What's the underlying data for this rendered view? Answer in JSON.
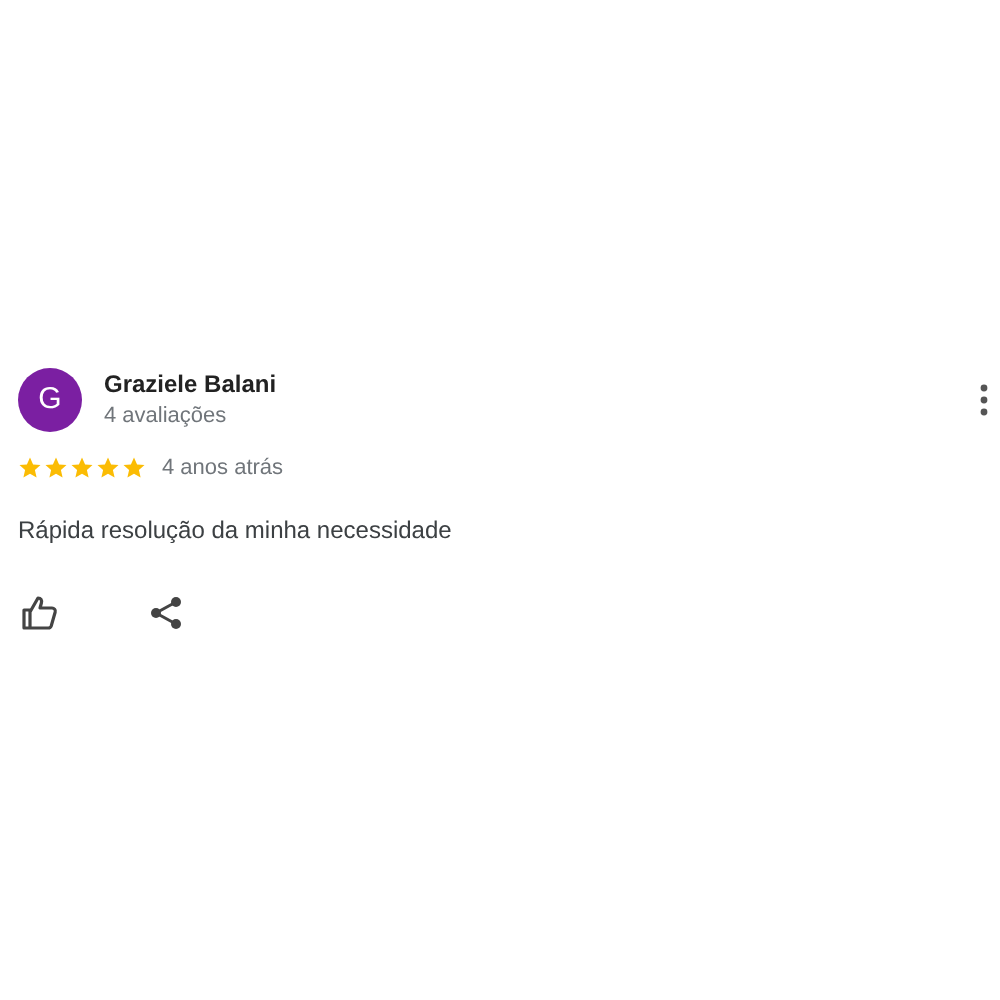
{
  "review": {
    "avatar_letter": "G",
    "author": "Graziele Balani",
    "review_count": "4 avaliações",
    "stars": 5,
    "time": "4 anos atrás",
    "text": "Rápida resolução da minha necessidade"
  }
}
